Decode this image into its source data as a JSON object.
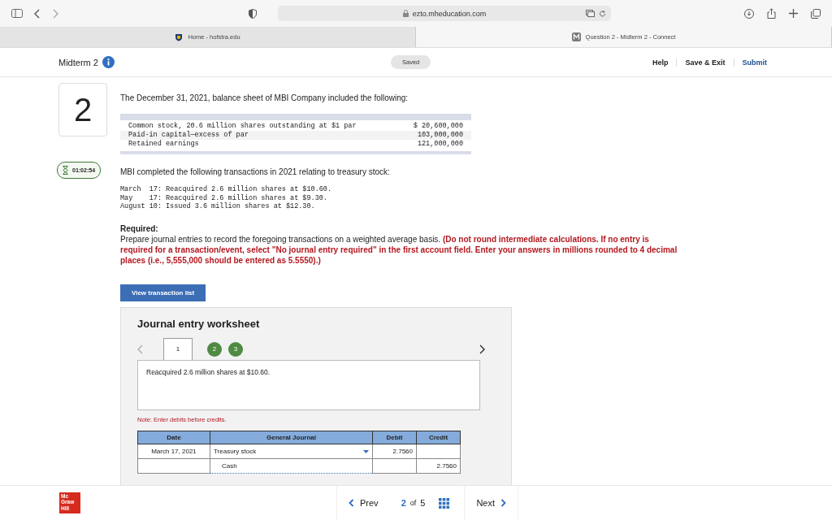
{
  "browser": {
    "url": "ezto.mheducation.com",
    "tabs": [
      {
        "label": "Home - hofstra.edu",
        "selected": false
      },
      {
        "label": "Question 2 - Midterm 2 - Connect",
        "selected": true
      }
    ]
  },
  "header": {
    "title": "Midterm 2",
    "status": "Saved",
    "actions": [
      "Help",
      "Save & Exit",
      "Submit"
    ]
  },
  "question": {
    "number": "2",
    "timer": "01:02:54",
    "intro": "The December 31, 2021, balance sheet of MBI Company included the following:",
    "balance_sheet": [
      {
        "label": "Common stock, 20.6 million shares outstanding at $1 par",
        "amount": "$ 20,600,000"
      },
      {
        "label": "Paid-in capital—excess of par",
        "amount": "103,000,000"
      },
      {
        "label": "Retained earnings",
        "amount": "121,000,000"
      }
    ],
    "transactions_intro": "MBI completed the following transactions in 2021 relating to treasury stock:",
    "transactions": [
      {
        "date": "March  17:",
        "text": "Reacquired 2.6 million shares at $10.60."
      },
      {
        "date": "May    17:",
        "text": "Reacquired 2.6 million shares at $9.30."
      },
      {
        "date": "August 10:",
        "text": "Issued 3.6 million shares at $12.30."
      }
    ],
    "required_label": "Required:",
    "required_text": "Prepare journal entries to record the foregoing transactions on a weighted average basis.",
    "required_note": "(Do not round intermediate calculations. If no entry is required for a transaction/event, select \"No journal entry required\" in the first account field. Enter your answers in millions rounded to 4 decimal places (i.e., 5,555,000 should be entered as 5.5550).)",
    "view_button": "View transaction list"
  },
  "worksheet": {
    "title": "Journal entry worksheet",
    "tabs": [
      {
        "label": "1",
        "selected": true
      },
      {
        "label": "2",
        "selected": false
      },
      {
        "label": "3",
        "selected": false
      }
    ],
    "description": "Reacquired 2.6 million shares at $10.60.",
    "note": "Note: Enter debits before credits.",
    "columns": [
      "Date",
      "General Journal",
      "Debit",
      "Credit"
    ],
    "rows": [
      {
        "date": "March 17, 2021",
        "account": "Treasury stock",
        "debit": "2.7560",
        "credit": "",
        "indent": false
      },
      {
        "date": "",
        "account": "Cash",
        "debit": "",
        "credit": "2.7560",
        "indent": true
      }
    ]
  },
  "footer": {
    "logo": [
      "Mc",
      "Graw",
      "Hill"
    ],
    "prev": "Prev",
    "current": "2",
    "of": "of",
    "total": "5",
    "next": "Next"
  }
}
